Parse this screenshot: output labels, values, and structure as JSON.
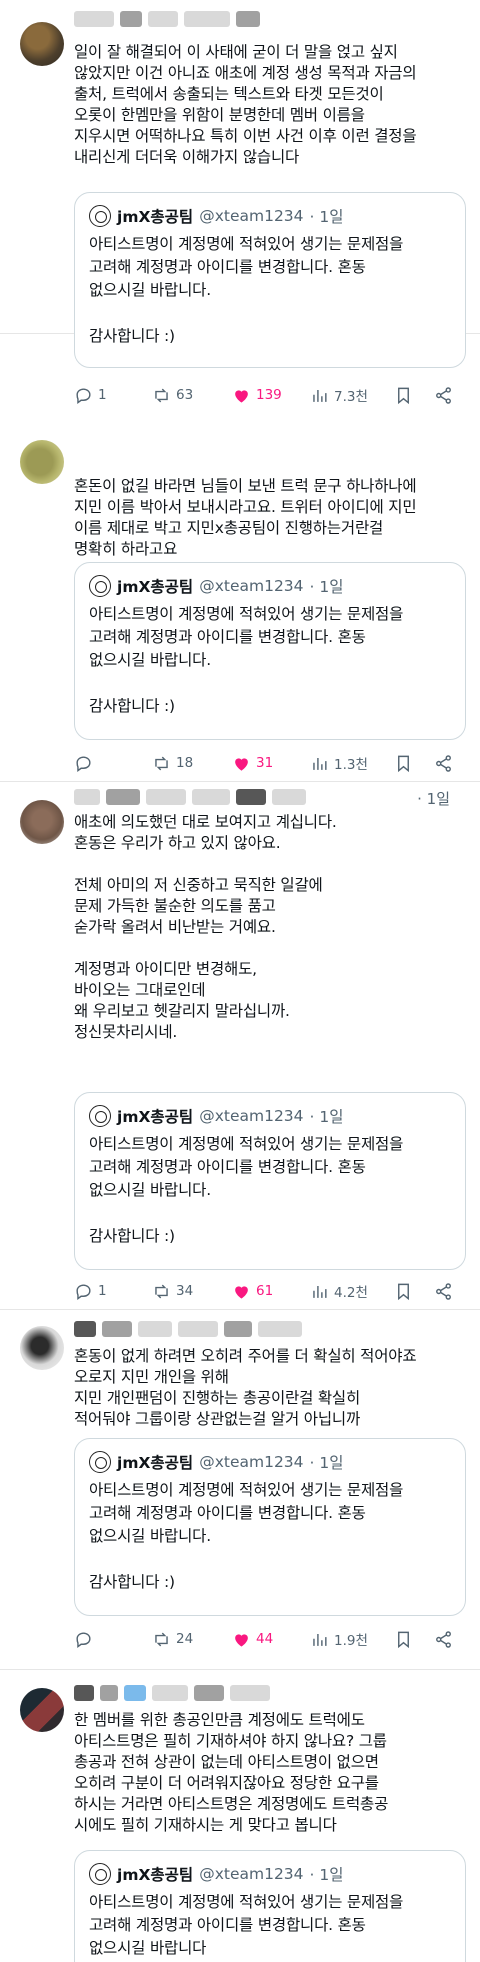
{
  "shared_quote": {
    "name": "jmX총공팀",
    "handle": "@xteam1234",
    "date": "· 1일",
    "text": "아티스트명이 계정명에 적혀있어 생기는 문제점을\n고려해 계정명과 아이디를 변경합니다. 혼동\n없으시길 바랍니다.\n\n감사합니다 :)",
    "text_cut": "아티스트명이 계정명에 적혀있어 생기는 문제점을\n고려해 계정명과 아이디를 변경합니다. 혼동\n없으시길 바랍니다"
  },
  "tweets": [
    {
      "text": "일이 잘 해결되어 이 사태에 굳이 더 말을 얹고 싶지\n않았지만 이건 아니죠 애초에 계정 생성 목적과 자금의\n출처, 트럭에서 송출되는 텍스트와 타겟 모든것이\n오롯이 한멤만을 위함이 분명한데 멤버 이름을\n지우시면 어떡하나요 특히 이번 사건 이후 이런 결정을\n내리신게 더더욱 이해가지 않습니다",
      "replies": "1",
      "retweets": "63",
      "likes": "139",
      "views": "7.3천"
    },
    {
      "text": "혼돈이 없길 바라면 님들이 보낸 트럭 문구 하나하나에\n지민 이름 박아서 보내시라고요. 트위터 아이디에 지민\n이름 제대로 박고 지민x총공팀이 진행하는거란걸\n명확히 하라고요",
      "replies": "",
      "retweets": "18",
      "likes": "31",
      "views": "1.3천"
    },
    {
      "date": "· 1일",
      "text": "애초에 의도했던 대로 보여지고 계십니다.\n혼동은 우리가 하고 있지 않아요.\n\n전체 아미의 저 신중하고 묵직한 일갈에\n문제 가득한 불순한 의도를 품고\n숟가락 올려서 비난받는 거예요.\n\n계정명과 아이디만 변경해도,\n바이오는 그대로인데\n왜 우리보고 헷갈리지 말라십니까.\n정신못차리시네.",
      "replies": "1",
      "retweets": "34",
      "likes": "61",
      "views": "4.2천"
    },
    {
      "text": "혼동이 없게 하려면 오히려 주어를 더 확실히 적어야죠\n오로지 지민 개인을 위해\n지민 개인팬덤이 진행하는 총공이란걸 확실히\n적어둬야 그룹이랑 상관없는걸 알거 아닙니까",
      "replies": "",
      "retweets": "24",
      "likes": "44",
      "views": "1.9천"
    },
    {
      "text": "한 멤버를 위한 총공인만큼 계정에도 트럭에도\n아티스트명은 필히 기재하셔야 하지 않나요? 그룹\n총공과 전혀 상관이 없는데 아티스트명이 없으면\n오히려 구분이 더 어려워지잖아요 정당한 요구를\n하시는 거라면 아티스트명은 계정명에도 트럭총공\n시에도 필히 기재하시는 게 맞다고 봅니다"
    }
  ]
}
